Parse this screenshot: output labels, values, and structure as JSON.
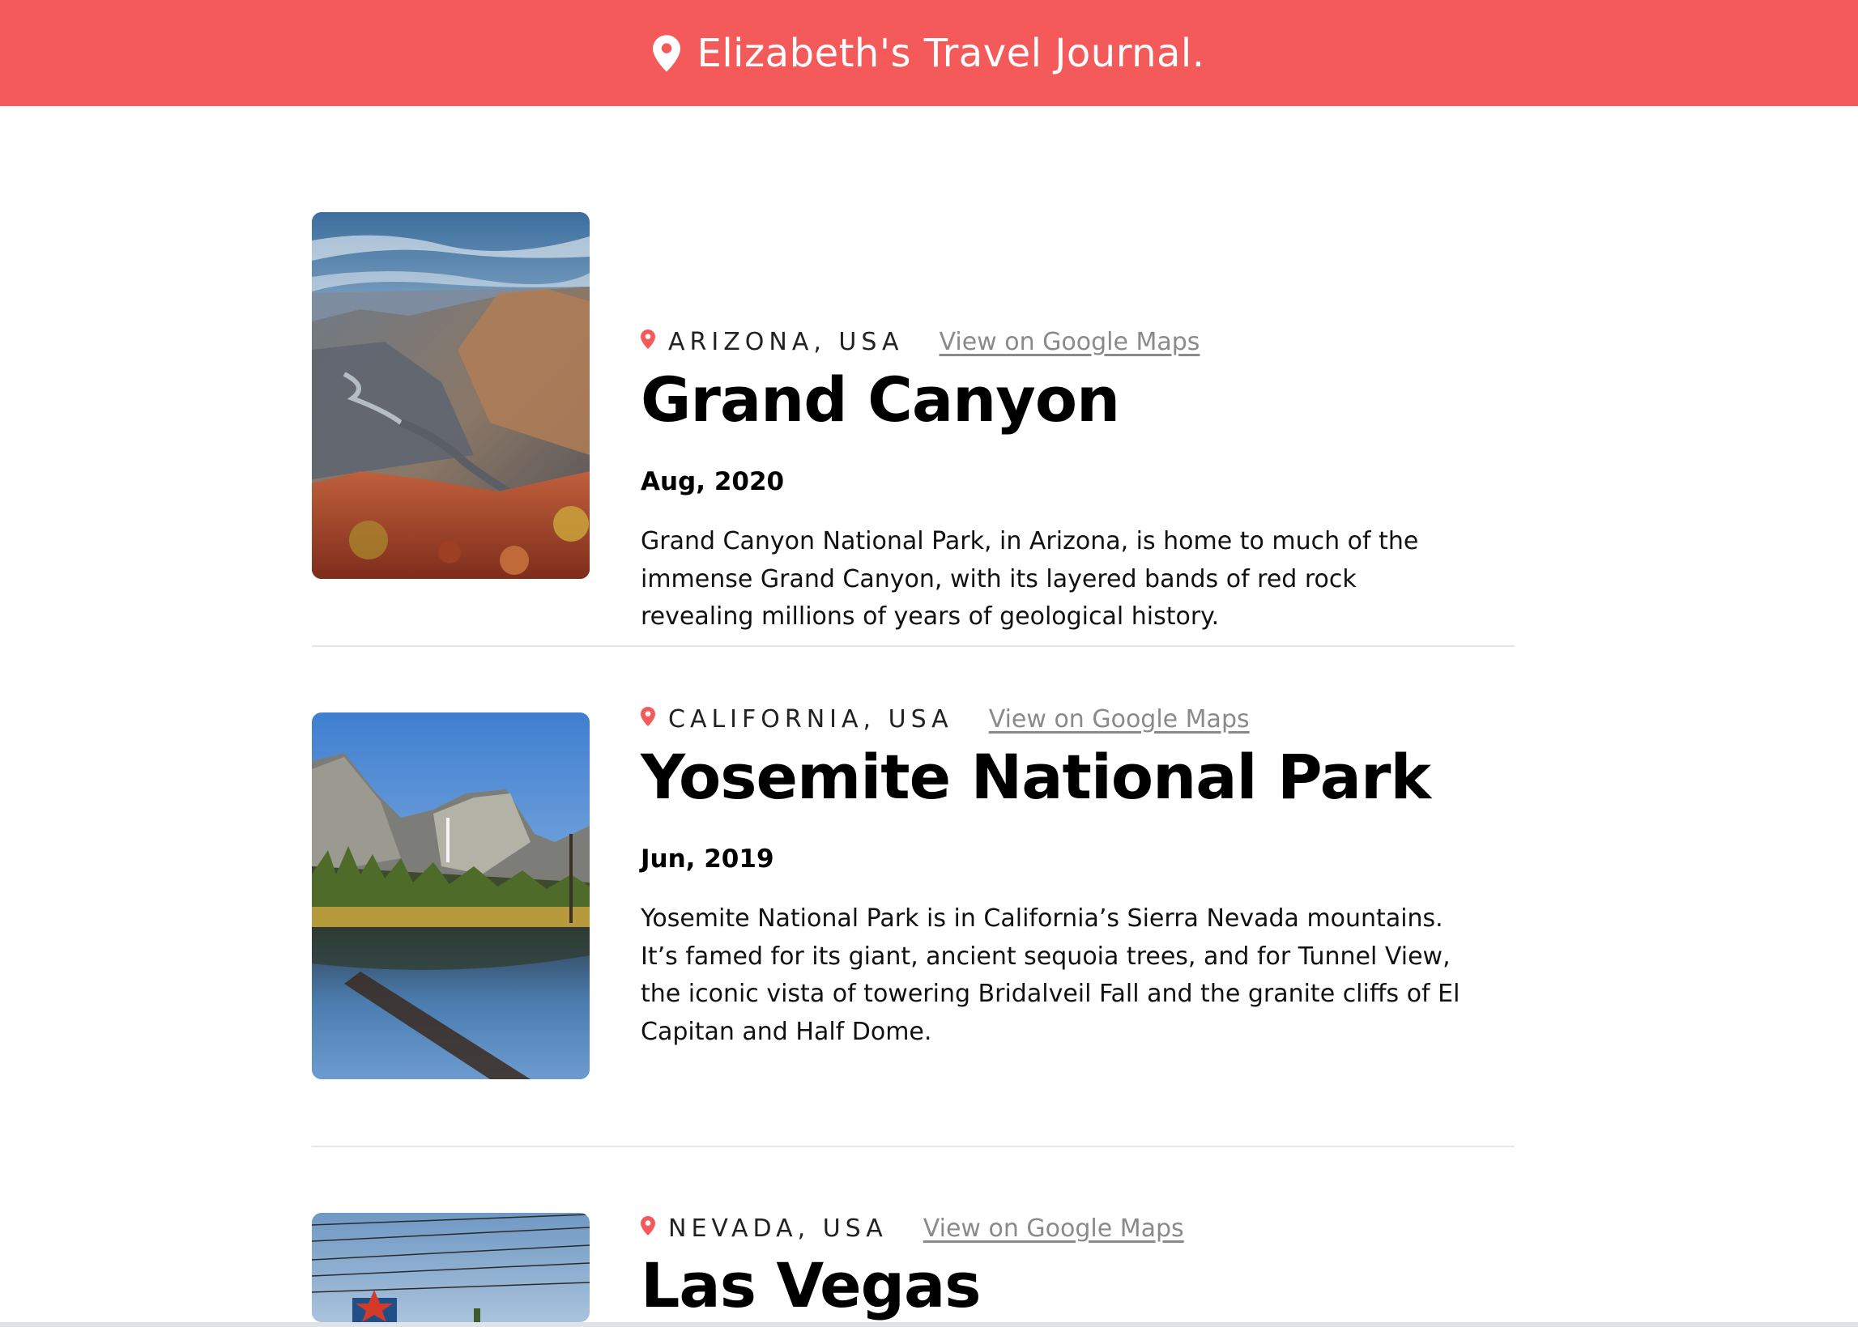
{
  "header": {
    "title": "Elizabeth's Travel Journal.",
    "background_color": "#F55A5A",
    "icon": "map-pin-icon"
  },
  "entries": [
    {
      "location": "ARIZONA, USA",
      "maps_link": "View on Google Maps",
      "title": "Grand Canyon",
      "date": "Aug, 2020",
      "description": "Grand Canyon National Park, in Arizona, is home to much of the immense Grand Canyon, with its layered bands of red rock revealing millions of years of geological history."
    },
    {
      "location": "CALIFORNIA, USA",
      "maps_link": "View on Google Maps",
      "title": "Yosemite National Park",
      "date": "Jun, 2019",
      "description": "Yosemite National Park is in California’s Sierra Nevada mountains. It’s famed for its giant, ancient sequoia trees, and for Tunnel View, the iconic vista of towering Bridalveil Fall and the granite cliffs of El Capitan and Half Dome."
    },
    {
      "location": "NEVADA, USA",
      "maps_link": "View on Google Maps",
      "title": "Las Vegas"
    }
  ],
  "colors": {
    "accent": "#F55A5A",
    "link": "#8a8a8a",
    "divider": "#e6e6e6"
  }
}
